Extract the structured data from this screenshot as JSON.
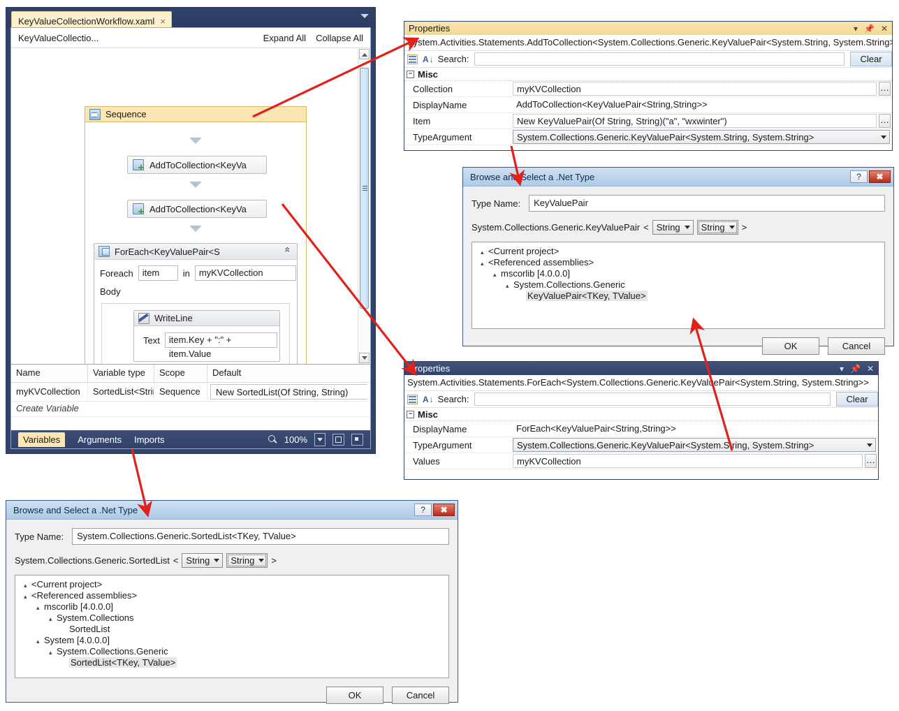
{
  "designer": {
    "tab_label": "KeyValueCollectionWorkflow.xaml",
    "tab_close": "×",
    "breadcrumb": "KeyValueCollectio...",
    "expand_all": "Expand All",
    "collapse_all": "Collapse All",
    "activities": {
      "sequence": "Sequence",
      "add1": "AddToCollection<KeyVa",
      "add2": "AddToCollection<KeyVa",
      "foreach_title": "ForEach<KeyValuePair<S",
      "foreach_label": "Foreach",
      "foreach_item": "item",
      "foreach_in": "in",
      "foreach_collection": "myKVCollection",
      "body_label": "Body",
      "writeline": "WriteLine",
      "text_label": "Text",
      "text_value": "item.Key + \":\" + item.Value"
    },
    "variables": {
      "headers": [
        "Name",
        "Variable type",
        "Scope",
        "Default"
      ],
      "rows": [
        {
          "name": "myKVCollection",
          "type": "SortedList<String",
          "scope": "Sequence",
          "default": "New SortedList(Of String, String)"
        }
      ],
      "create_label": "Create Variable"
    },
    "status_tabs": [
      "Variables",
      "Arguments",
      "Imports"
    ],
    "zoom_level": "100%"
  },
  "properties_top": {
    "title": "Properties",
    "type_line": "System.Activities.Statements.AddToCollection<System.Collections.Generic.KeyValuePair<System.String, System.String>>",
    "search_label": "Search:",
    "search_value": "",
    "clear_label": "Clear",
    "group_label": "Misc",
    "group_toggle": "−",
    "rows": [
      {
        "name": "Collection",
        "value": "myKVCollection",
        "kind": "text",
        "ellipsis": true
      },
      {
        "name": "DisplayName",
        "value": "AddToCollection<KeyValuePair<String,String>>",
        "kind": "plain",
        "ellipsis": false
      },
      {
        "name": "Item",
        "value": "New KeyValuePair(Of String, String)(\"a\", \"wxwinter\")",
        "kind": "text",
        "ellipsis": true
      },
      {
        "name": "TypeArgument",
        "value": "System.Collections.Generic.KeyValuePair<System.String, System.String>",
        "kind": "combo",
        "ellipsis": false
      }
    ]
  },
  "properties_bottom": {
    "title": "Properties",
    "type_line": "System.Activities.Statements.ForEach<System.Collections.Generic.KeyValuePair<System.String, System.String>>",
    "search_label": "Search:",
    "search_value": "",
    "clear_label": "Clear",
    "group_label": "Misc",
    "group_toggle": "−",
    "rows": [
      {
        "name": "DisplayName",
        "value": "ForEach<KeyValuePair<String,String>>",
        "kind": "plain",
        "ellipsis": false
      },
      {
        "name": "TypeArgument",
        "value": "System.Collections.Generic.KeyValuePair<System.String, System.String>",
        "kind": "combo",
        "ellipsis": false
      },
      {
        "name": "Values",
        "value": "myKVCollection",
        "kind": "text",
        "ellipsis": true
      }
    ]
  },
  "dialog_top": {
    "title": "Browse and Select a .Net Type",
    "help_label": "?",
    "close_label": "✖",
    "type_name_label": "Type Name:",
    "type_name_value": "KeyValuePair",
    "generic_prefix": "System.Collections.Generic.KeyValuePair",
    "open_bracket": "<",
    "close_bracket": ">",
    "generic_args": [
      "String",
      "String"
    ],
    "tree": [
      {
        "indent": 0,
        "twisty": "▴",
        "text": "<Current project>",
        "selected": false
      },
      {
        "indent": 0,
        "twisty": "▴",
        "text": "<Referenced assemblies>",
        "selected": false
      },
      {
        "indent": 1,
        "twisty": "▴",
        "text": "mscorlib [4.0.0.0]",
        "selected": false
      },
      {
        "indent": 2,
        "twisty": "▴",
        "text": "System.Collections.Generic",
        "selected": false
      },
      {
        "indent": 3,
        "twisty": "",
        "text": "KeyValuePair<TKey, TValue>",
        "selected": true
      }
    ],
    "ok_label": "OK",
    "cancel_label": "Cancel"
  },
  "dialog_bottom": {
    "title": "Browse and Select a .Net Type",
    "help_label": "?",
    "close_label": "✖",
    "type_name_label": "Type Name:",
    "type_name_value": "System.Collections.Generic.SortedList<TKey, TValue>",
    "generic_prefix": "System.Collections.Generic.SortedList",
    "open_bracket": "<",
    "close_bracket": ">",
    "generic_args": [
      "String",
      "String"
    ],
    "tree": [
      {
        "indent": 0,
        "twisty": "▴",
        "text": "<Current project>",
        "selected": false
      },
      {
        "indent": 0,
        "twisty": "▴",
        "text": "<Referenced assemblies>",
        "selected": false
      },
      {
        "indent": 1,
        "twisty": "▴",
        "text": "mscorlib [4.0.0.0]",
        "selected": false
      },
      {
        "indent": 2,
        "twisty": "▴",
        "text": "System.Collections",
        "selected": false
      },
      {
        "indent": 3,
        "twisty": "",
        "text": "SortedList",
        "selected": false
      },
      {
        "indent": 1,
        "twisty": "▴",
        "text": "System [4.0.0.0]",
        "selected": false
      },
      {
        "indent": 2,
        "twisty": "▴",
        "text": "System.Collections.Generic",
        "selected": false
      },
      {
        "indent": 3,
        "twisty": "",
        "text": "SortedList<TKey, TValue>",
        "selected": true
      }
    ],
    "ok_label": "OK",
    "cancel_label": "Cancel"
  },
  "annotation": {
    "arrow_color": "#e1211a"
  }
}
